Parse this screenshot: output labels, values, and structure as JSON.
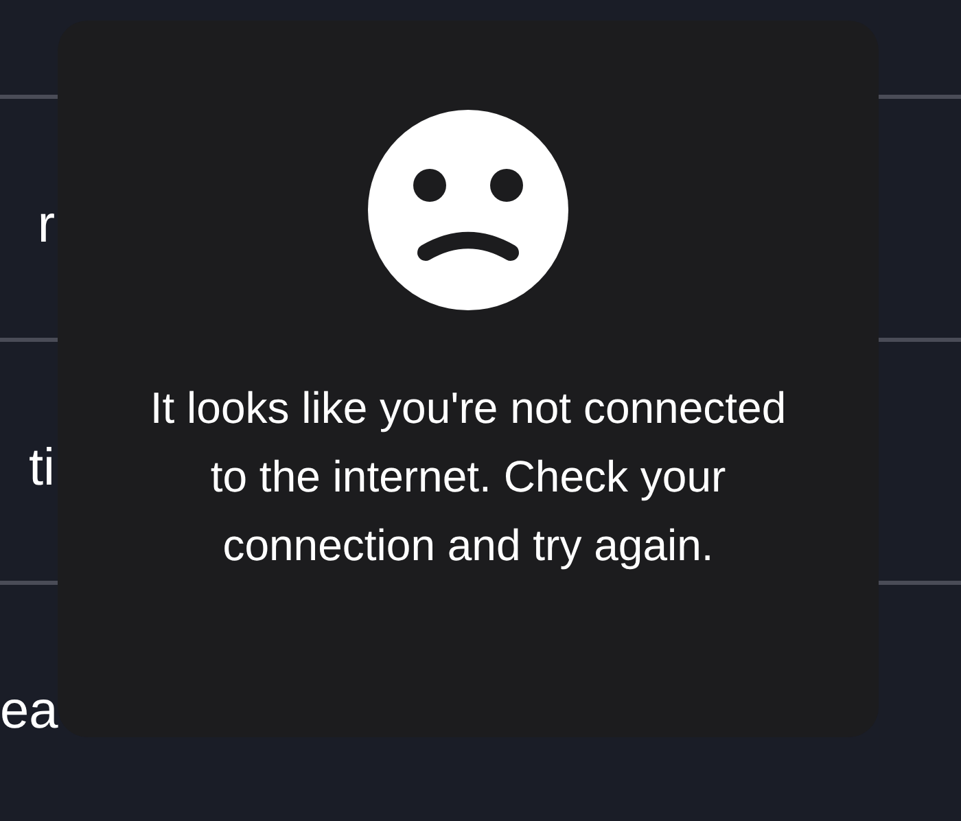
{
  "background_list": {
    "rows": [
      {
        "label": "r"
      },
      {
        "label": "ti"
      },
      {
        "label": "ea"
      }
    ]
  },
  "offline_overlay": {
    "message": "It looks like you're not connected to the internet. Check your connection and try again."
  }
}
